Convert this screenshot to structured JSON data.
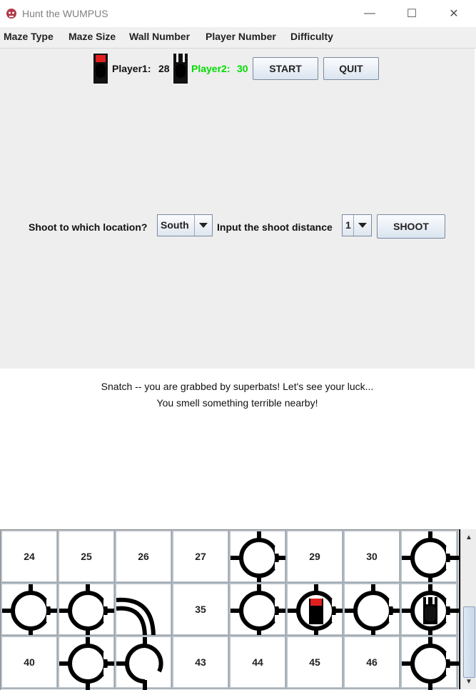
{
  "window": {
    "title": "Hunt the WUMPUS",
    "minimize": "—",
    "maximize": "☐",
    "close": "✕"
  },
  "menu": [
    "Maze Type",
    "Maze Size",
    "Wall Number",
    "Player Number",
    "Difficulty"
  ],
  "players": {
    "p1_label": "Player1:",
    "p1_arrows": "28",
    "p2_label": "Player2:",
    "p2_arrows": "30",
    "p2_color": "#00dd00"
  },
  "buttons": {
    "start": "START",
    "quit": "QUIT",
    "shoot": "SHOOT"
  },
  "shoot_form": {
    "direction_label": "Shoot to which location?",
    "direction_value": "South",
    "distance_label": "Input the shoot distance",
    "distance_value": "1"
  },
  "messages": [
    "Snatch -- you are grabbed by superbats! Let's see your luck...",
    "You smell something terrible nearby!"
  ],
  "maze": {
    "rows": [
      [
        {
          "num": "24",
          "shape": "none"
        },
        {
          "num": "25",
          "shape": "none"
        },
        {
          "num": "26",
          "shape": "none"
        },
        {
          "num": "27",
          "shape": "none"
        },
        {
          "num": "",
          "shape": "ring"
        },
        {
          "num": "29",
          "shape": "none"
        },
        {
          "num": "30",
          "shape": "none"
        },
        {
          "num": "",
          "shape": "ring"
        }
      ],
      [
        {
          "num": "",
          "shape": "ring"
        },
        {
          "num": "",
          "shape": "ring"
        },
        {
          "num": "",
          "shape": "curve"
        },
        {
          "num": "35",
          "shape": "none"
        },
        {
          "num": "",
          "shape": "ring"
        },
        {
          "num": "",
          "shape": "ring-p1"
        },
        {
          "num": "",
          "shape": "ring"
        },
        {
          "num": "",
          "shape": "ring-p2"
        }
      ],
      [
        {
          "num": "40",
          "shape": "none"
        },
        {
          "num": "",
          "shape": "ring"
        },
        {
          "num": "",
          "shape": "ring-half"
        },
        {
          "num": "43",
          "shape": "none"
        },
        {
          "num": "44",
          "shape": "none"
        },
        {
          "num": "45",
          "shape": "none"
        },
        {
          "num": "46",
          "shape": "none"
        },
        {
          "num": "",
          "shape": "ring"
        }
      ]
    ]
  },
  "colors": {
    "panel": "#eeeeee",
    "player1_marker": "#e02020"
  }
}
